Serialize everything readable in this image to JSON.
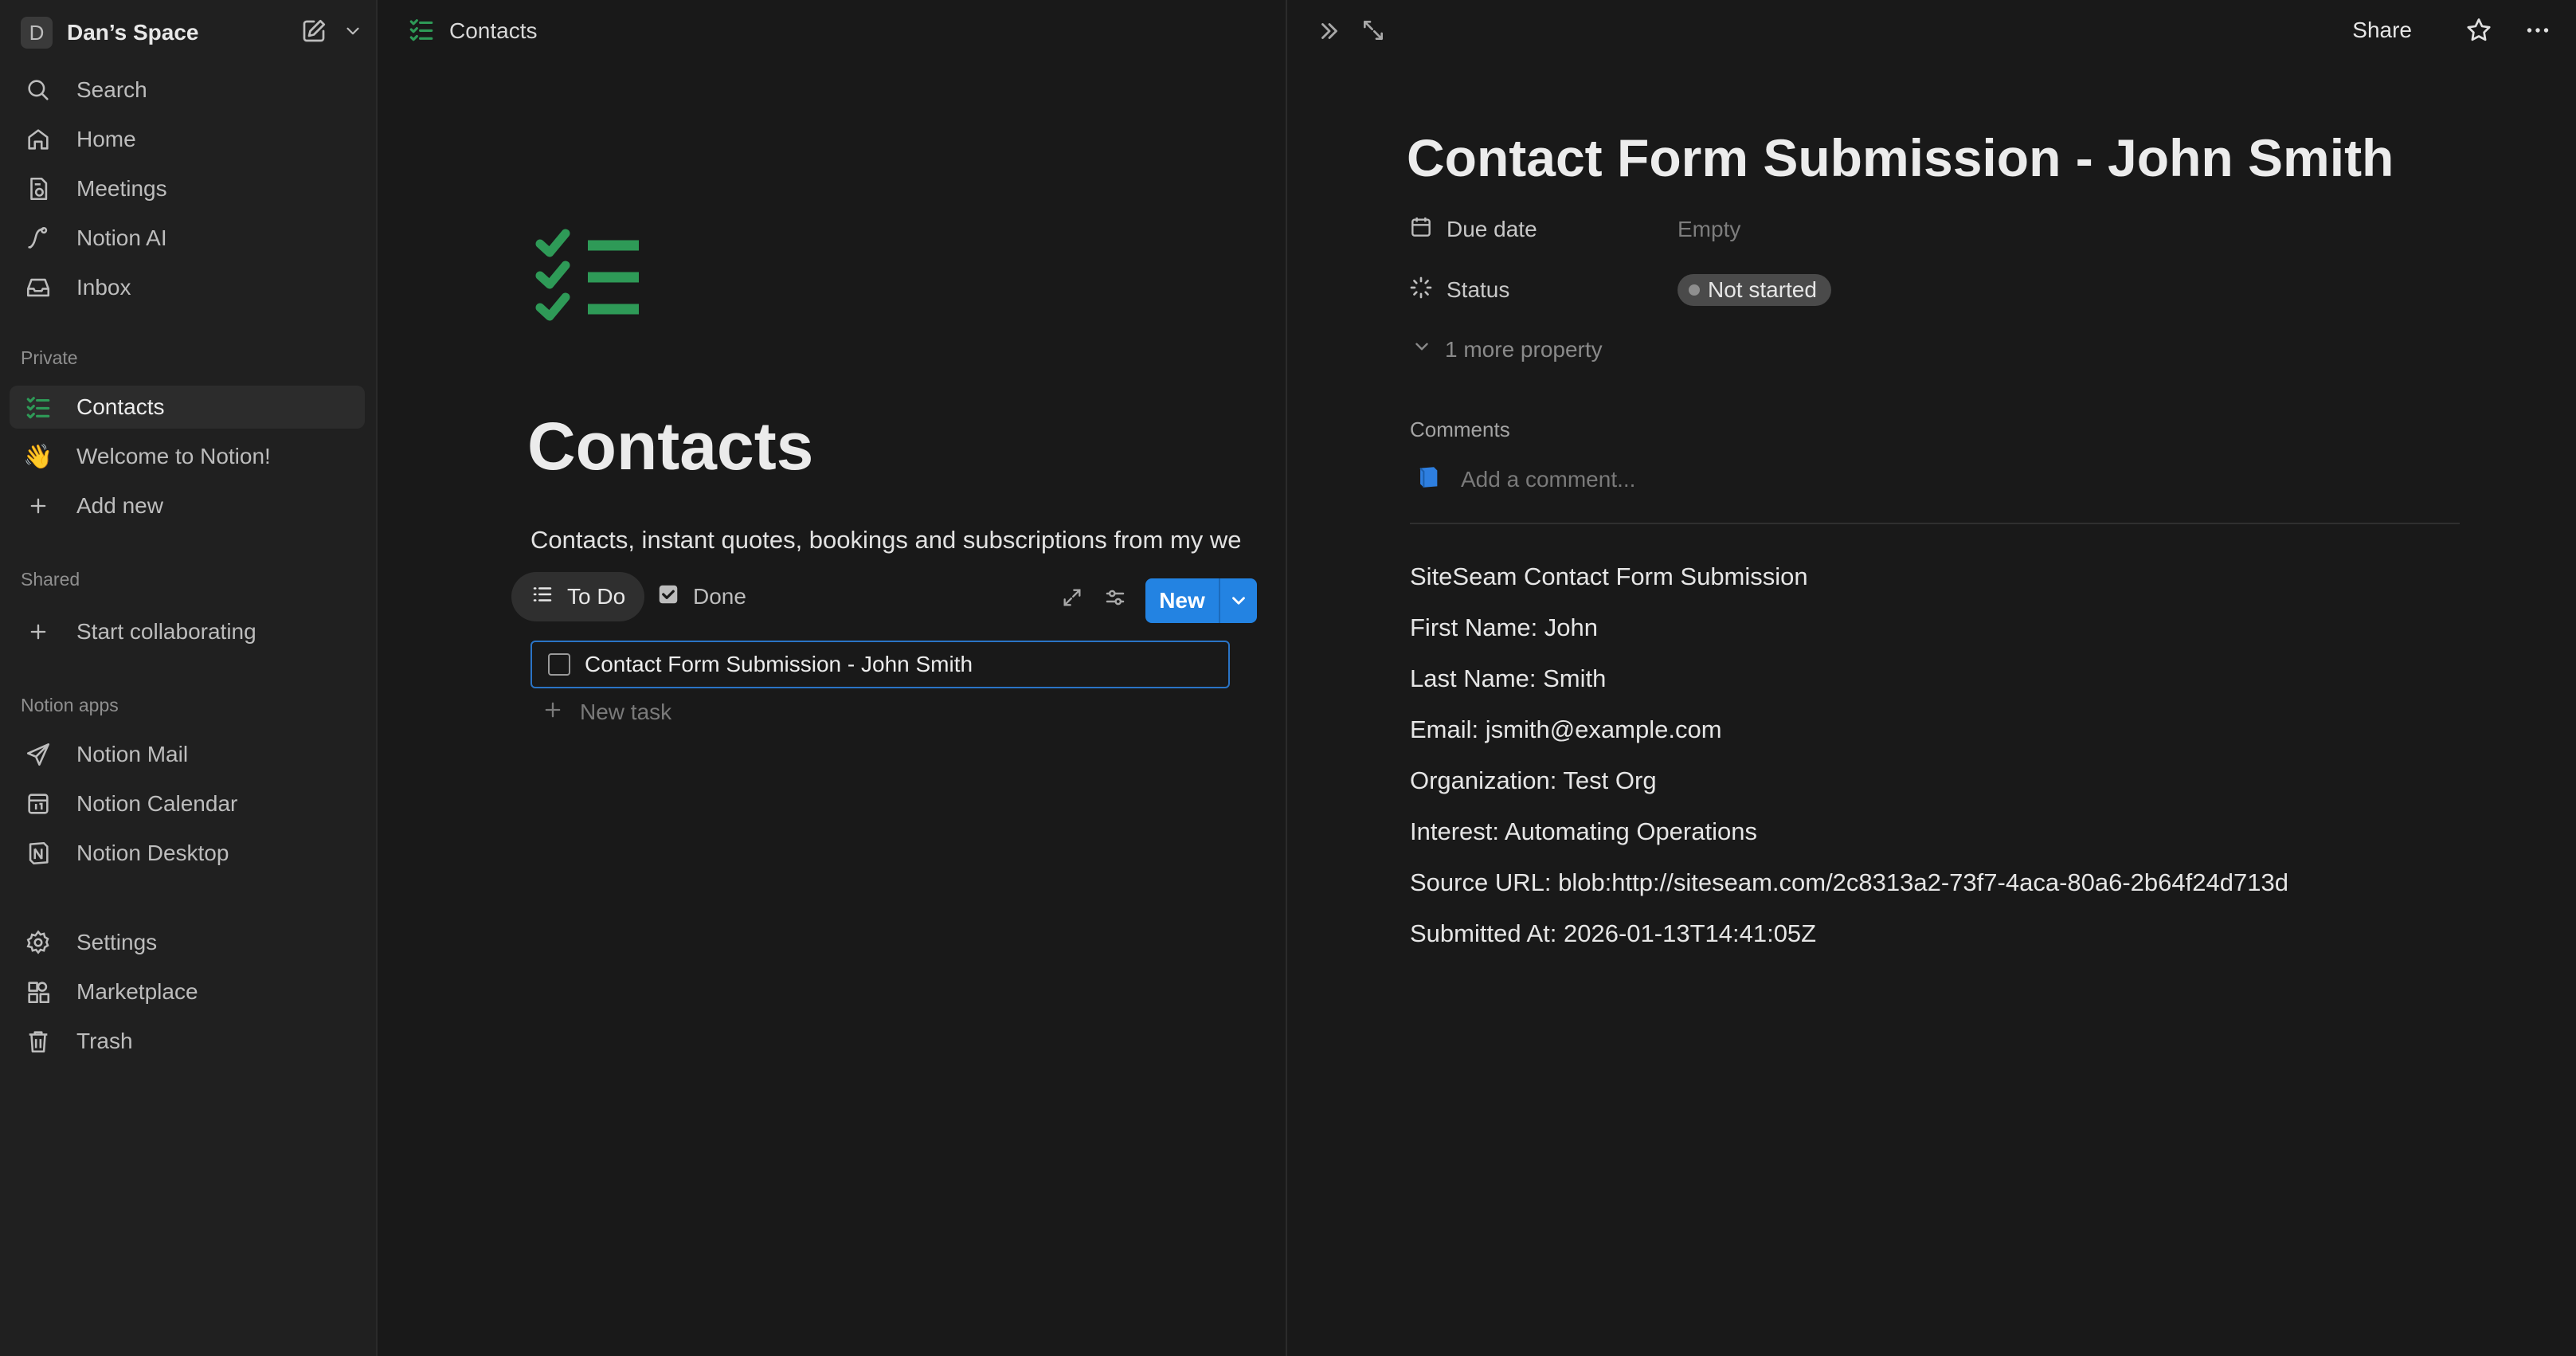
{
  "sidebar": {
    "workspace_initial": "D",
    "workspace_name": "Dan’s Space",
    "nav": [
      {
        "label": "Search"
      },
      {
        "label": "Home"
      },
      {
        "label": "Meetings"
      },
      {
        "label": "Notion AI"
      },
      {
        "label": "Inbox"
      }
    ],
    "private_label": "Private",
    "private_items": [
      {
        "label": "Contacts",
        "active": true
      },
      {
        "label": "Welcome to Notion!",
        "emoji": "👋"
      },
      {
        "label": "Add new"
      }
    ],
    "shared_label": "Shared",
    "shared_items": [
      {
        "label": "Start collaborating"
      }
    ],
    "apps_label": "Notion apps",
    "apps": [
      {
        "label": "Notion Mail"
      },
      {
        "label": "Notion Calendar"
      },
      {
        "label": "Notion Desktop"
      }
    ],
    "bottom": [
      {
        "label": "Settings"
      },
      {
        "label": "Marketplace"
      },
      {
        "label": "Trash"
      }
    ]
  },
  "middle": {
    "breadcrumb": "Contacts",
    "title": "Contacts",
    "description": "Contacts, instant quotes, bookings and subscriptions from my we",
    "views": [
      {
        "label": "To Do",
        "active": true
      },
      {
        "label": "Done"
      }
    ],
    "new_button": "New",
    "tasks": [
      {
        "label": "Contact Form Submission - John Smith",
        "checked": false
      }
    ],
    "new_task": "New task"
  },
  "detail": {
    "share": "Share",
    "title": "Contact Form Submission - John Smith",
    "properties": [
      {
        "name": "Due date",
        "value": "Empty"
      },
      {
        "name": "Status",
        "value": "Not started"
      }
    ],
    "more_property": "1 more property",
    "comments_label": "Comments",
    "comment_placeholder": "Add a comment...",
    "body": [
      "SiteSeam Contact Form Submission",
      "First Name: John",
      "Last Name: Smith",
      "Email: jsmith@example.com",
      "Organization: Test Org",
      "Interest: Automating Operations",
      "Source URL: blob:http://siteseam.com/2c8313a2-73f7-4aca-80a6-2b64f24d713d",
      "Submitted At: 2026-01-13T14:41:05Z"
    ]
  },
  "colors": {
    "accent": "#2383e2",
    "checklist_green": "#2e9a57",
    "sidebar_bg": "#202020",
    "page_bg": "#191919"
  }
}
